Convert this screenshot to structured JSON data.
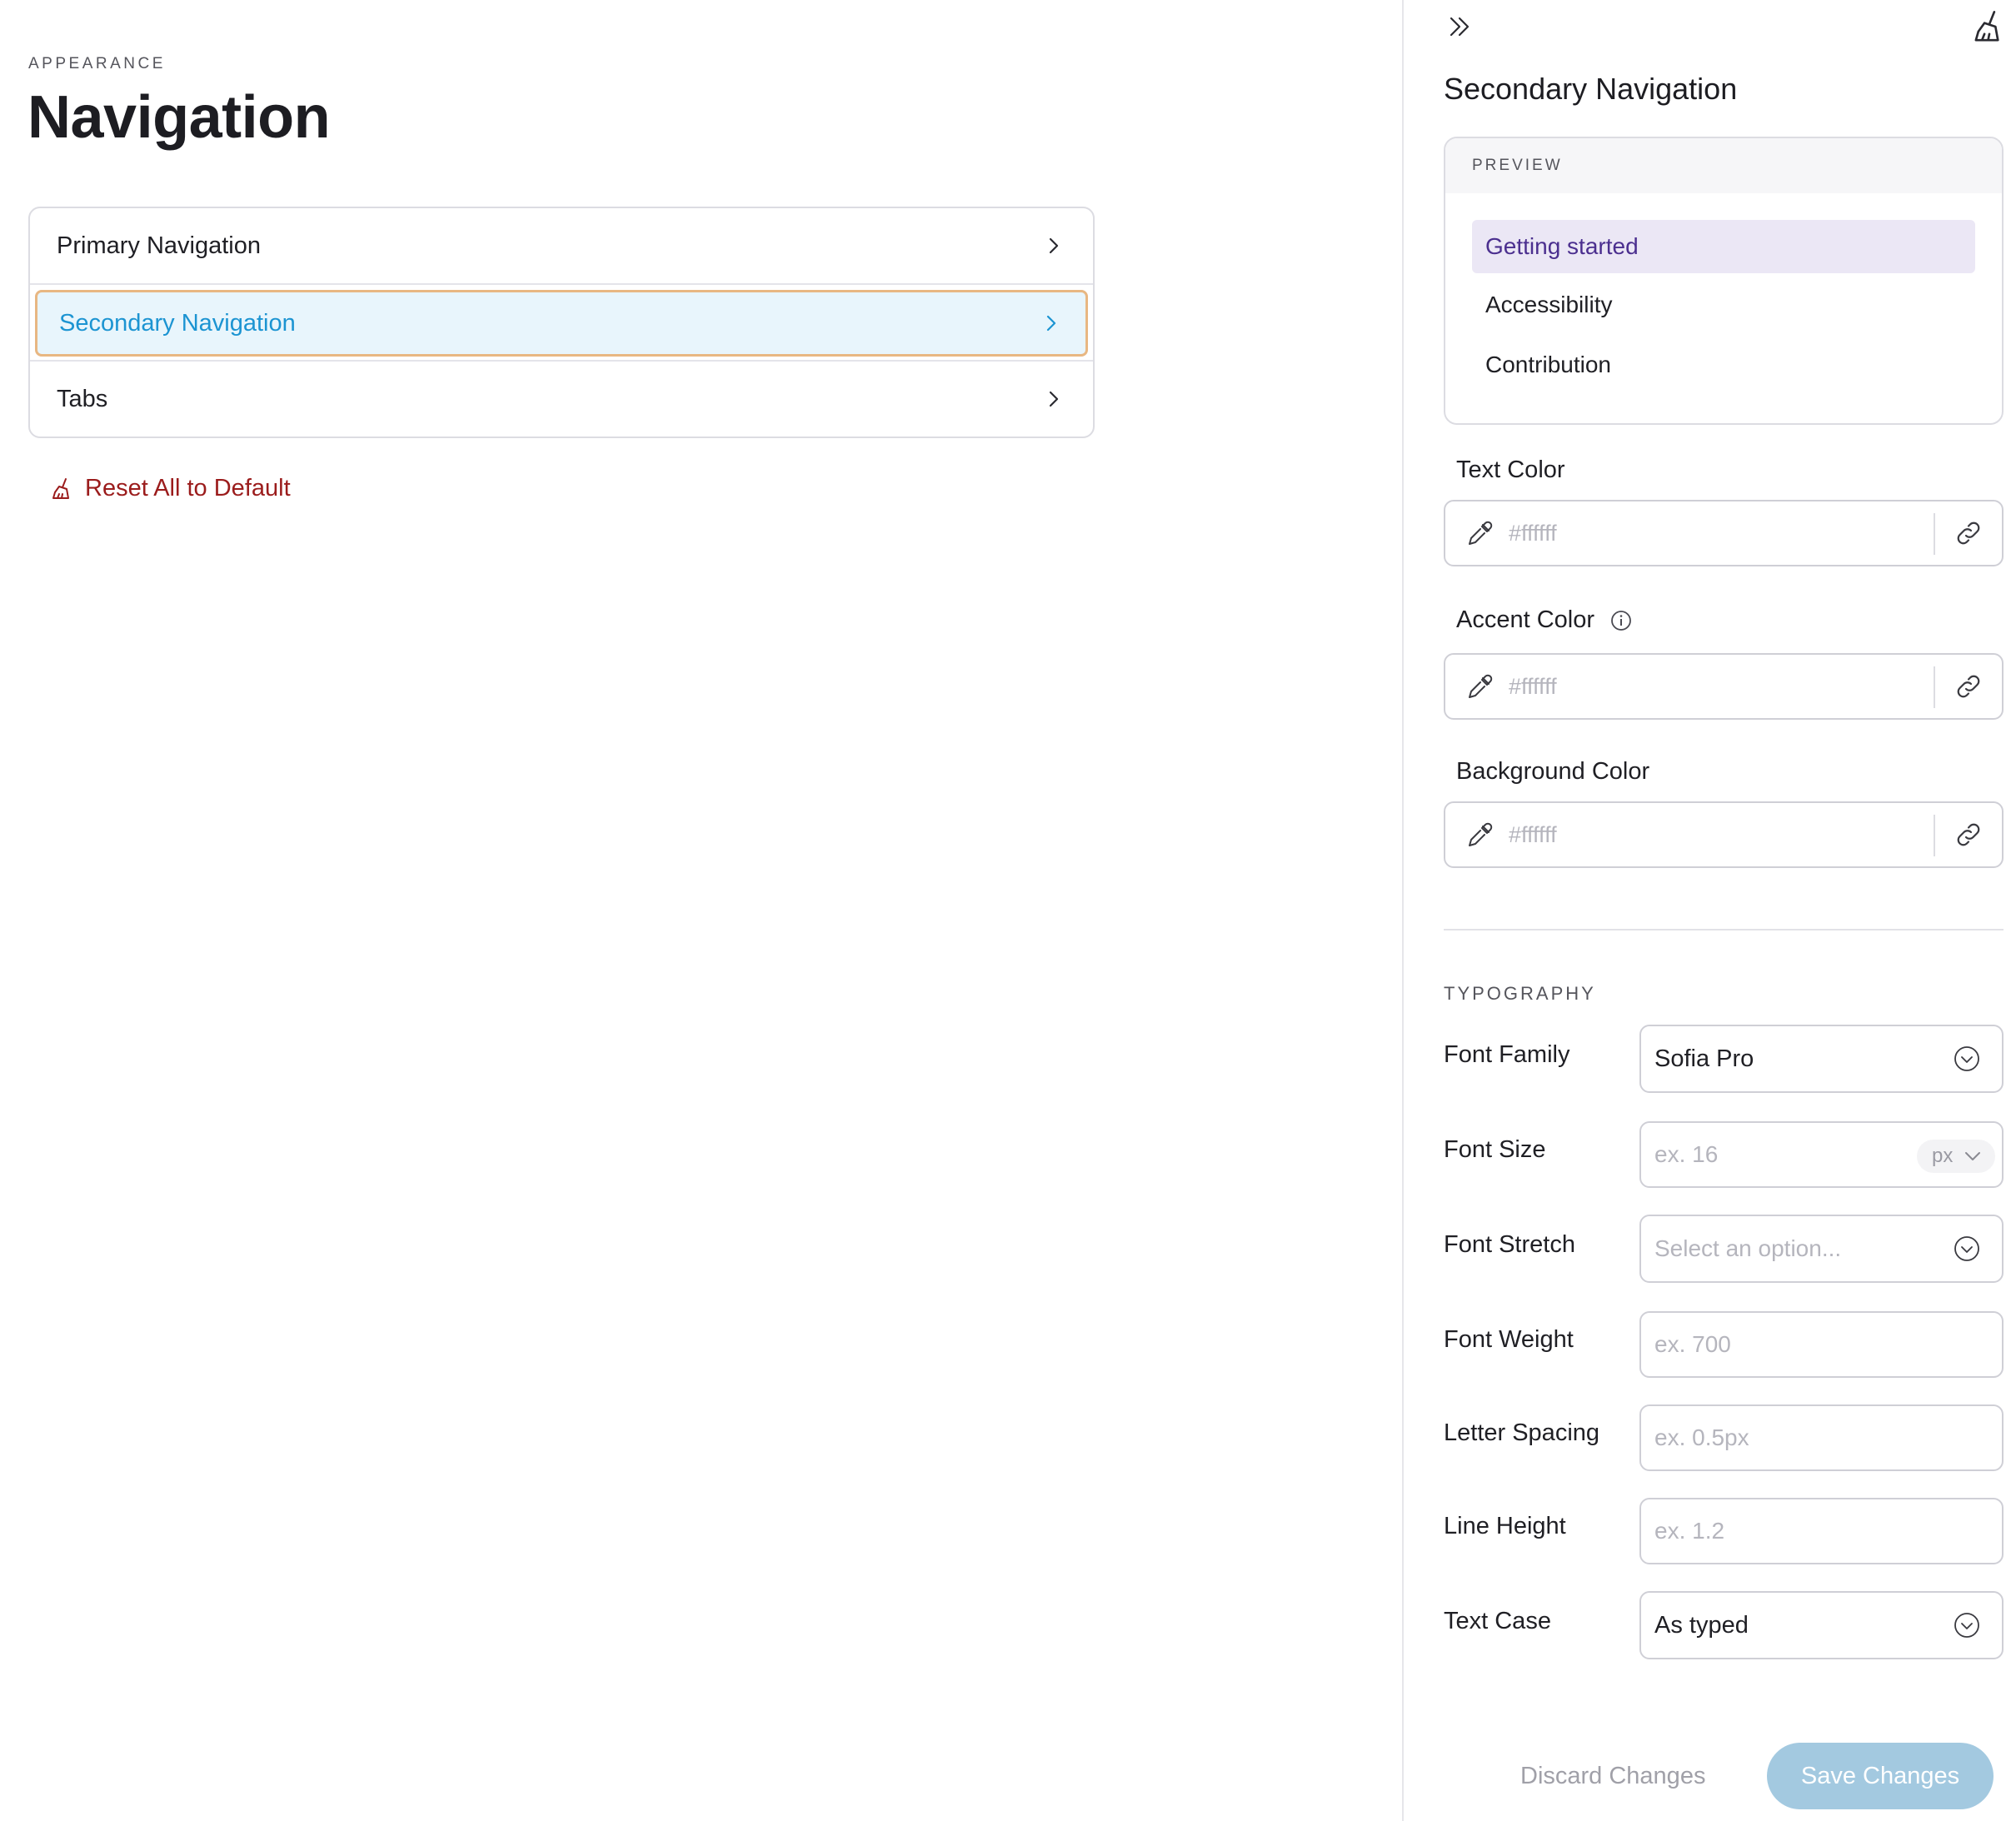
{
  "header": {
    "eyebrow": "APPEARANCE",
    "title": "Navigation"
  },
  "nav_list": {
    "items": [
      {
        "label": "Primary Navigation",
        "selected": false
      },
      {
        "label": "Secondary Navigation",
        "selected": true
      },
      {
        "label": "Tabs",
        "selected": false
      }
    ]
  },
  "reset": {
    "label": "Reset All to Default",
    "icon": "brush-icon"
  },
  "panel": {
    "title": "Secondary Navigation",
    "collapse_icon": "double-chevron-right-icon",
    "reset_icon": "brush-icon",
    "preview": {
      "label": "PREVIEW",
      "items": [
        "Getting started",
        "Accessibility",
        "Contribution"
      ],
      "active_index": 0
    },
    "colors": {
      "text": {
        "label": "Text Color",
        "value": "#ffffff"
      },
      "accent": {
        "label": "Accent Color",
        "value": "#ffffff",
        "has_info": true
      },
      "background": {
        "label": "Background Color",
        "value": "#ffffff"
      }
    },
    "typography": {
      "label": "TYPOGRAPHY",
      "font_family": {
        "label": "Font Family",
        "value": "Sofia Pro"
      },
      "font_size": {
        "label": "Font Size",
        "placeholder": "ex. 16",
        "unit": "px"
      },
      "font_stretch": {
        "label": "Font Stretch",
        "placeholder": "Select an option..."
      },
      "font_weight": {
        "label": "Font Weight",
        "placeholder": "ex. 700"
      },
      "letter_spacing": {
        "label": "Letter Spacing",
        "placeholder": "ex. 0.5px"
      },
      "line_height": {
        "label": "Line Height",
        "placeholder": "ex. 1.2"
      },
      "text_case": {
        "label": "Text Case",
        "value": "As typed"
      }
    },
    "actions": {
      "discard": "Discard Changes",
      "save": "Save Changes"
    }
  },
  "colors": {
    "selected_text": "#1c94d2",
    "selected_bg": "#e8f5fc",
    "selected_border": "#e8b782",
    "reset_text": "#9b1c1c",
    "preview_active_bg": "#ebe7f5",
    "preview_active_text": "#4b2f8f",
    "save_button_bg": "#a3c9e0"
  }
}
